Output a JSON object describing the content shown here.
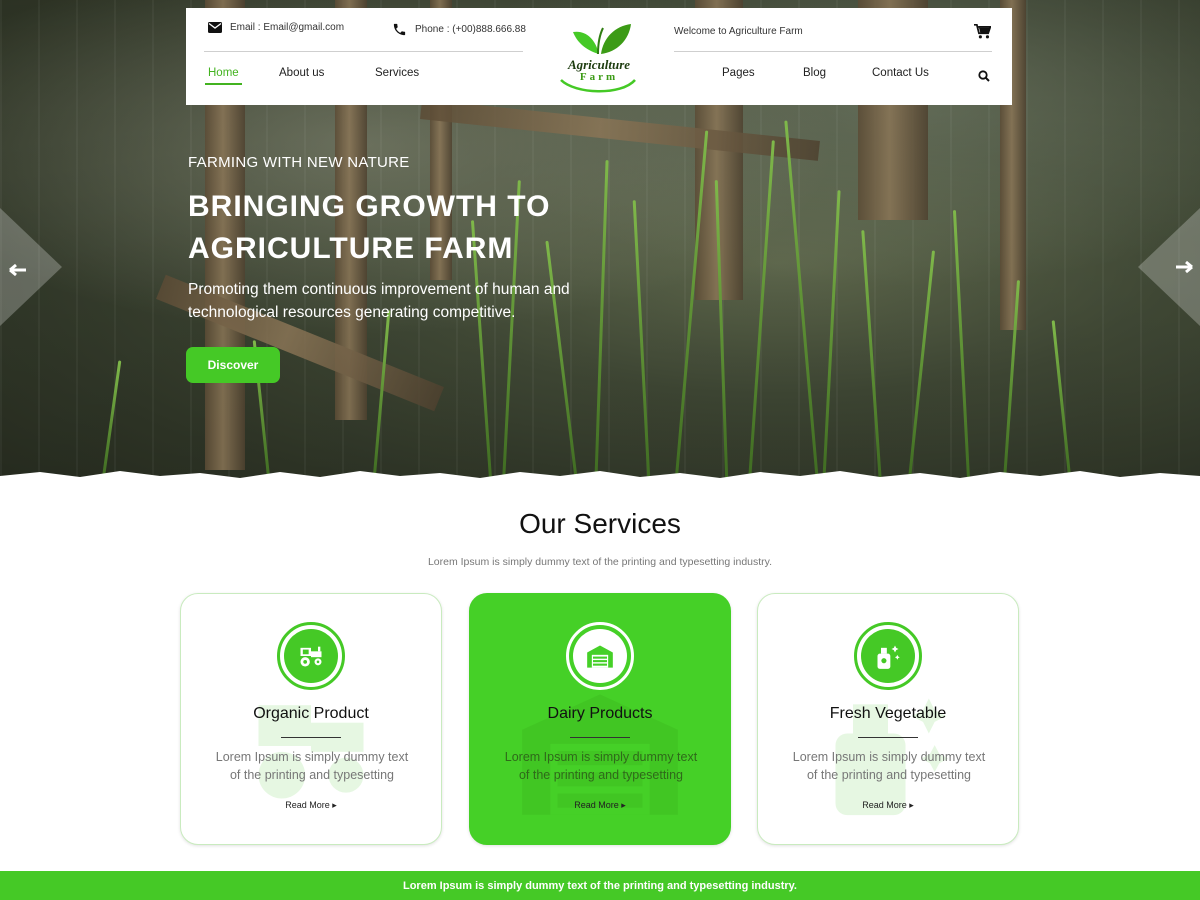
{
  "header": {
    "email": "Email : Email@gmail.com",
    "phone": "Phone : (+00)888.666.88",
    "welcome": "Welcome to Agriculture Farm",
    "logo_line1": "Agriculture",
    "logo_line2": "Farm",
    "nav_left": [
      "Home",
      "About us",
      "Services"
    ],
    "nav_right": [
      "Pages",
      "Blog",
      "Contact Us"
    ],
    "active_nav": "Home"
  },
  "hero": {
    "subtitle": "FARMING WITH NEW NATURE",
    "title_line1": "BRINGING GROWTH TO",
    "title_line2": "AGRICULTURE FARM",
    "description": "Promoting them continuous improvement of human and technological resources generating competitive.",
    "button": "Discover"
  },
  "services": {
    "title": "Our Services",
    "subtitle": "Lorem Ipsum is simply dummy text of the printing and typesetting industry.",
    "cards": [
      {
        "title": "Organic Product",
        "text": "Lorem Ipsum is simply dummy text of the printing and typesetting",
        "link": "Read More",
        "icon": "tractor-icon"
      },
      {
        "title": "Dairy Products",
        "text": "Lorem Ipsum is simply dummy text of the printing and typesetting",
        "link": "Read More",
        "icon": "warehouse-icon"
      },
      {
        "title": "Fresh Vegetable",
        "text": "Lorem Ipsum is simply dummy text of the printing and typesetting",
        "link": "Read More",
        "icon": "spray-bottle-icon"
      }
    ]
  },
  "footer": {
    "text": "Lorem Ipsum is simply dummy text of the printing and typesetting industry."
  },
  "colors": {
    "accent": "#45c926",
    "accent_dark": "#3c9b16",
    "text": "#222222",
    "muted": "#777777"
  }
}
